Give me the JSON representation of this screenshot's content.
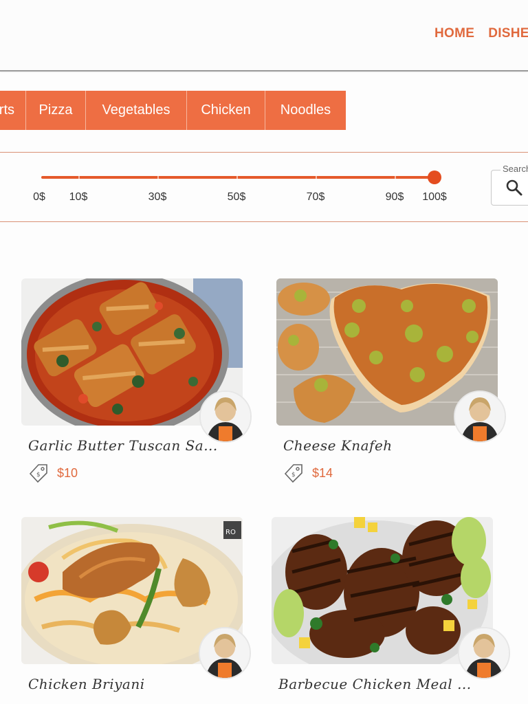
{
  "nav": {
    "items": [
      "HOME",
      "DISHES"
    ]
  },
  "categories": [
    "Desserts",
    "Pizza",
    "Vegetables",
    "Chicken",
    "Noodles"
  ],
  "price_filter": {
    "ticks": [
      "0$",
      "10$",
      "30$",
      "50$",
      "70$",
      "90$",
      "100$"
    ],
    "value": 100,
    "max": 100
  },
  "search": {
    "label": "Search"
  },
  "dishes": [
    {
      "title": "Garlic Butter Tuscan Sa...",
      "price": "$10"
    },
    {
      "title": "Cheese Knafeh",
      "price": "$14"
    },
    {
      "title": "Chicken Briyani",
      "price": ""
    },
    {
      "title": "Barbecue Chicken Meal ...",
      "price": ""
    }
  ],
  "image_badge": "RO",
  "colors": {
    "accent": "#ee6e43",
    "accent_text": "#e0693d",
    "slider": "#e55a2b"
  }
}
